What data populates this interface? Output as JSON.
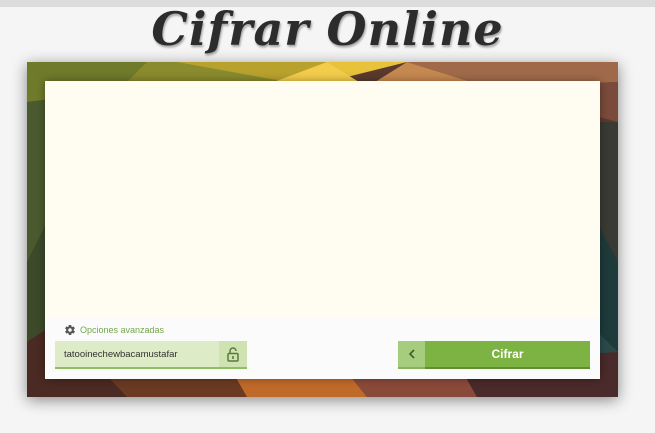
{
  "app": {
    "logo_text": "Cifrar Online"
  },
  "editor": {
    "text": ""
  },
  "options": {
    "advanced_label": "Opciones avanzadas",
    "icon": "gear-icon"
  },
  "key": {
    "value": "tatooinechewbacamustafar",
    "icon": "lock-icon"
  },
  "actions": {
    "back_icon": "chevron-left-icon",
    "submit_label": "Cifrar"
  },
  "colors": {
    "accent": "#7cb342",
    "accent_light": "#a5cd7d",
    "key_field_bg": "#ddebc6",
    "option_text": "#74a54b"
  }
}
